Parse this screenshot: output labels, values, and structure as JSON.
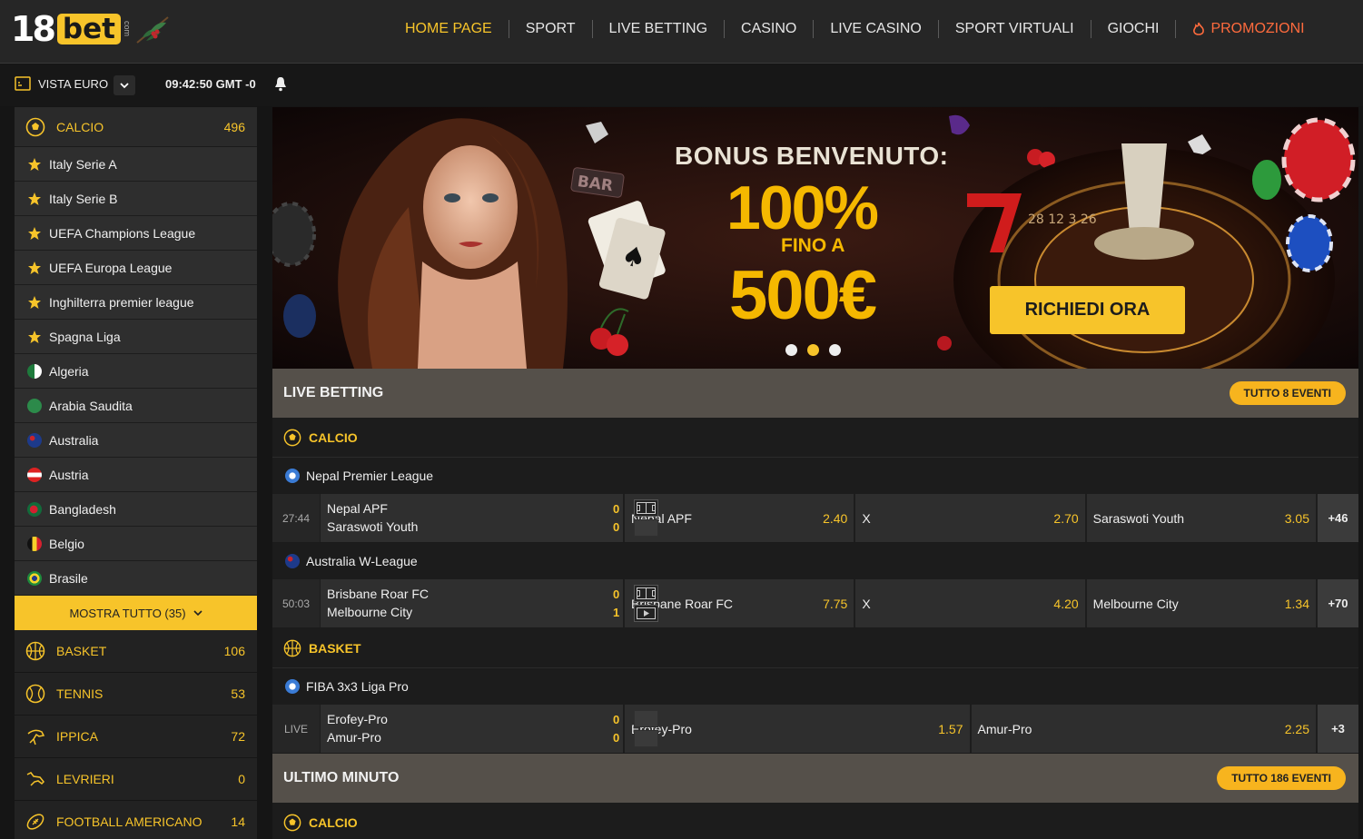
{
  "header": {
    "logo": {
      "num": "18",
      "word": "bet",
      "tld": "com"
    },
    "nav": [
      {
        "label": "HOME PAGE"
      },
      {
        "label": "SPORT"
      },
      {
        "label": "LIVE BETTING"
      },
      {
        "label": "CASINO"
      },
      {
        "label": "LIVE CASINO"
      },
      {
        "label": "SPORT VIRTUALI"
      },
      {
        "label": "GIOCHI"
      },
      {
        "label": "PROMOZIONI"
      }
    ]
  },
  "subbar": {
    "view_label": "VISTA EURO",
    "clock": "09:42:50 GMT -0"
  },
  "sidebar": {
    "top_sport": {
      "label": "CALCIO",
      "count": "496"
    },
    "leagues": [
      {
        "label": "Italy Serie A"
      },
      {
        "label": "Italy Serie B"
      },
      {
        "label": "UEFA Champions League"
      },
      {
        "label": "UEFA Europa League"
      },
      {
        "label": "Inghilterra premier league"
      },
      {
        "label": "Spagna Liga"
      },
      {
        "label": "Algeria"
      },
      {
        "label": "Arabia Saudita"
      },
      {
        "label": "Australia"
      },
      {
        "label": "Austria"
      },
      {
        "label": "Bangladesh"
      },
      {
        "label": "Belgio"
      },
      {
        "label": "Brasile"
      }
    ],
    "show_all": "MOSTRA TUTTO (35)",
    "sports": [
      {
        "label": "BASKET",
        "count": "106"
      },
      {
        "label": "TENNIS",
        "count": "53"
      },
      {
        "label": "IPPICA",
        "count": "72"
      },
      {
        "label": "LEVRIERI",
        "count": "0"
      },
      {
        "label": "FOOTBALL AMERICANO",
        "count": "14"
      }
    ]
  },
  "banner": {
    "title": "BONUS BENVENUTO:",
    "percent": "100%",
    "fino": "FINO A",
    "amount": "500€",
    "cta": "RICHIEDI ORA",
    "bar_sign": "BAR",
    "wheel_numbers": "28 12 3 26"
  },
  "live": {
    "title": "LIVE BETTING",
    "all_label": "TUTTO 8 EVENTI",
    "calcio": "CALCIO",
    "basket": "BASKET",
    "comps": [
      {
        "name": "Nepal Premier League"
      },
      {
        "name": "Australia W-League"
      },
      {
        "name": "FIBA 3x3 Liga Pro"
      }
    ],
    "matches": [
      {
        "time": "27:44",
        "home": "Nepal APF",
        "away": "Saraswoti Youth",
        "hs": "0",
        "as": "0",
        "o1n": "Nepal APF",
        "o1": "2.40",
        "oxn": "X",
        "ox": "2.70",
        "o2n": "Saraswoti Youth",
        "o2": "3.05",
        "more": "+46"
      },
      {
        "time": "50:03",
        "home": "Brisbane Roar FC",
        "away": "Melbourne City",
        "hs": "0",
        "as": "1",
        "o1n": "Brisbane Roar FC",
        "o1": "7.75",
        "oxn": "X",
        "ox": "4.20",
        "o2n": "Melbourne City",
        "o2": "1.34",
        "more": "+70"
      },
      {
        "time": "LIVE",
        "home": "Erofey-Pro",
        "away": "Amur-Pro",
        "hs": "0",
        "as": "0",
        "o1n": "Erofey-Pro",
        "o1": "1.57",
        "o2n": "Amur-Pro",
        "o2": "2.25",
        "more": "+3"
      }
    ]
  },
  "last_minute": {
    "title": "ULTIMO MINUTO",
    "all_label": "TUTTO 186 EVENTI",
    "calcio": "CALCIO"
  }
}
